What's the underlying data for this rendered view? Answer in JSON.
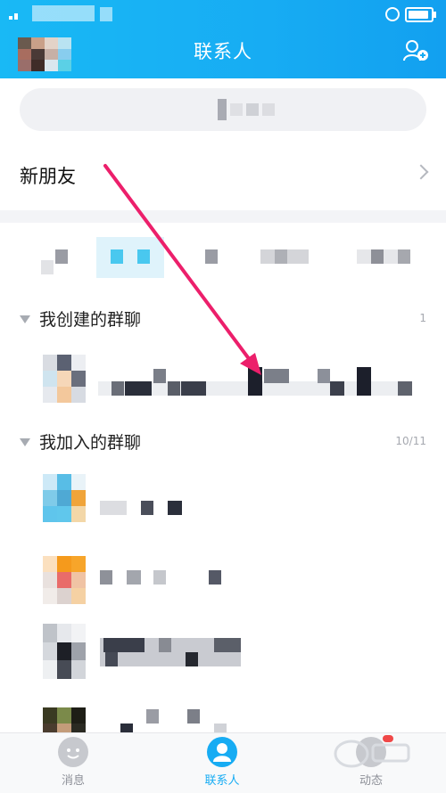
{
  "header": {
    "title": "联系人"
  },
  "menu": {
    "new_friends": "新朋友"
  },
  "sections": [
    {
      "label": "我创建的群聊",
      "count": "1"
    },
    {
      "label": "我加入的群聊",
      "count": "10/11"
    }
  ],
  "tabs": [
    {
      "label": "消息",
      "active": false
    },
    {
      "label": "联系人",
      "active": true
    },
    {
      "label": "动态",
      "active": false
    }
  ],
  "colors": {
    "accent": "#17acf3",
    "annotation_arrow": "#ec1f6b"
  }
}
